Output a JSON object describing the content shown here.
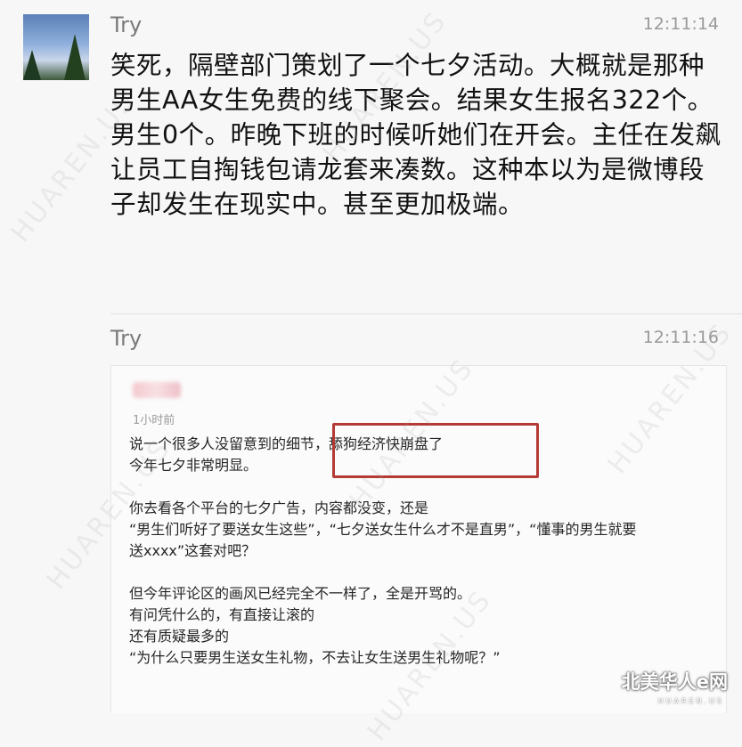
{
  "message1": {
    "sender": "Try",
    "time": "12:11:14",
    "text": "笑死，隔壁部门策划了一个七夕活动。大概就是那种男生AA女生免费的线下聚会。结果女生报名322个。男生0个。昨晚下班的时候听她们在开会。主任在发飙让员工自掏钱包请龙套来凑数。这种本以为是微博段子却发生在现实中。甚至更加极端。"
  },
  "message2": {
    "sender": "Try",
    "time": "12:11:16",
    "screenshot": {
      "post_time": "1小时前",
      "line1_prefix": "说一个很多人没留意到的细节，",
      "highlight": "舔狗经济快崩盘了",
      "line2": "今年七夕非常明显。",
      "para2_line1": "你去看各个平台的七夕广告，内容都没变，还是",
      "para2_line2": "“男生们听好了要送女生这些”，“七夕送女生什么才不是直男”，“懂事的男生就要",
      "para2_line3": "送xxxx”这套对吧？",
      "para3_line1": "但今年评论区的画风已经完全不一样了，全是开骂的。",
      "para3_line2": "有问凭什么的，有直接让滚的",
      "para3_line3": "还有质疑最多的",
      "para3_line4": "“为什么只要男生送女生礼物，不去让女生送男生礼物呢？”"
    }
  },
  "watermark": "HUAREN.US",
  "brand": {
    "name": "北美华人e网",
    "sub": "HUAREN.US"
  }
}
